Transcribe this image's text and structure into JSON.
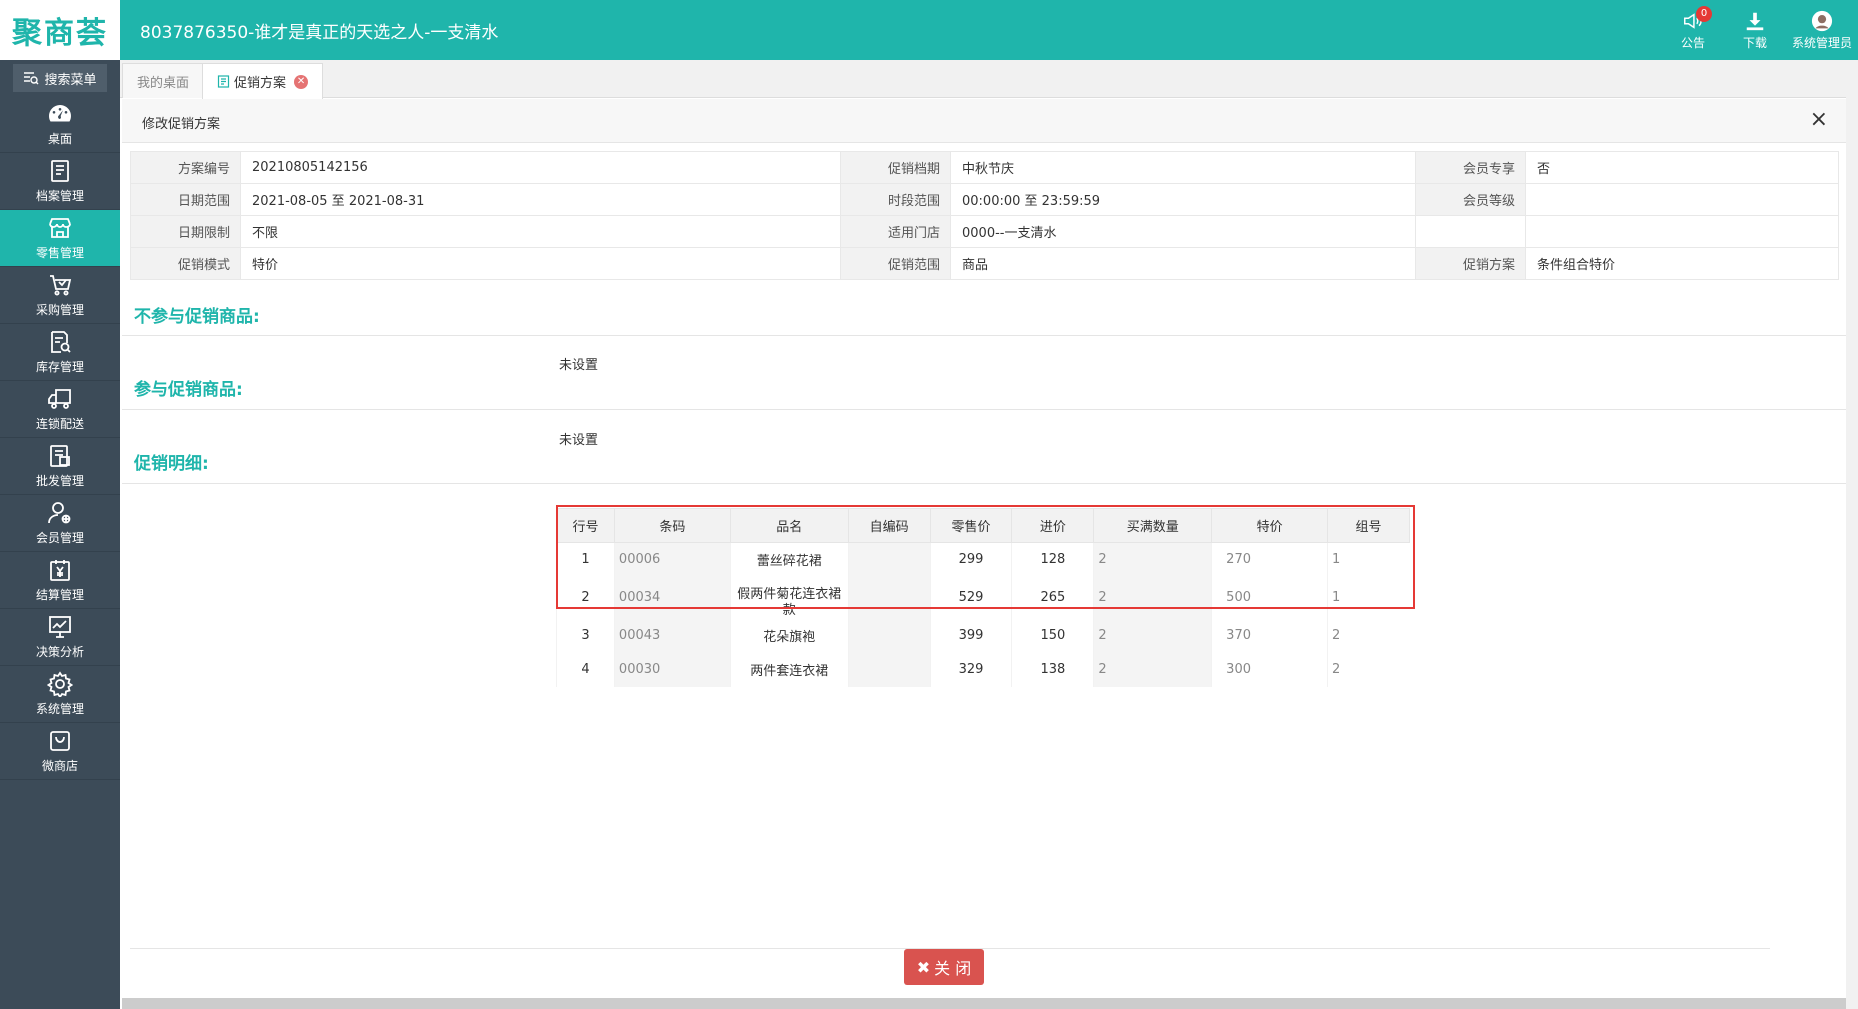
{
  "header": {
    "logo": "聚商荟",
    "title": "8037876350-谁才是真正的天选之人-一支清水",
    "actions": [
      {
        "label": "公告",
        "icon": "speaker-icon",
        "badge": "0"
      },
      {
        "label": "下载",
        "icon": "download-icon"
      },
      {
        "label": "系统管理员",
        "icon": "avatar-icon"
      }
    ]
  },
  "sidebar": {
    "search_label": "搜索菜单",
    "items": [
      {
        "label": "桌面",
        "icon": "dashboard-icon"
      },
      {
        "label": "档案管理",
        "icon": "archive-icon"
      },
      {
        "label": "零售管理",
        "icon": "store-icon",
        "active": true
      },
      {
        "label": "采购管理",
        "icon": "cart-icon"
      },
      {
        "label": "库存管理",
        "icon": "inventory-icon"
      },
      {
        "label": "连锁配送",
        "icon": "truck-icon"
      },
      {
        "label": "批发管理",
        "icon": "wholesale-icon"
      },
      {
        "label": "会员管理",
        "icon": "member-icon"
      },
      {
        "label": "结算管理",
        "icon": "settlement-icon"
      },
      {
        "label": "决策分析",
        "icon": "analysis-icon"
      },
      {
        "label": "系统管理",
        "icon": "gear-icon"
      },
      {
        "label": "微商店",
        "icon": "shop-bag-icon"
      }
    ]
  },
  "tabs": [
    {
      "label": "我的桌面"
    },
    {
      "label": "促销方案",
      "active": true
    }
  ],
  "panel": {
    "title": "修改促销方案",
    "close": "×"
  },
  "info": {
    "rows": [
      [
        {
          "label": "方案编号",
          "value": "20210805142156"
        },
        {
          "label": "促销档期",
          "value": "中秋节庆"
        },
        {
          "label": "会员专享",
          "value": "否"
        }
      ],
      [
        {
          "label": "日期范围",
          "value": "2021-08-05 至 2021-08-31"
        },
        {
          "label": "时段范围",
          "value": "00:00:00 至 23:59:59"
        },
        {
          "label": "会员等级",
          "value": ""
        }
      ],
      [
        {
          "label": "日期限制",
          "value": "不限"
        },
        {
          "label": "适用门店",
          "value": "0000--一支清水"
        },
        {
          "label": "",
          "value": ""
        }
      ],
      [
        {
          "label": "促销模式",
          "value": "特价"
        },
        {
          "label": "促销范围",
          "value": "商品"
        },
        {
          "label": "促销方案",
          "value": "条件组合特价"
        }
      ]
    ]
  },
  "sections": {
    "exclude_title": "不参与促销商品:",
    "exclude_value": "未设置",
    "include_title": "参与促销商品:",
    "include_value": "未设置",
    "detail_title": "促销明细:"
  },
  "detail": {
    "columns": [
      "行号",
      "条码",
      "品名",
      "自编码",
      "零售价",
      "进价",
      "买满数量",
      "特价",
      "组号"
    ],
    "rows": [
      {
        "no": "1",
        "barcode": "00006",
        "name": "蕾丝碎花裙",
        "code": "",
        "retail": "299",
        "cost": "128",
        "qty": "2",
        "special": "270",
        "group": "1"
      },
      {
        "no": "2",
        "barcode": "00034",
        "name": "假两件菊花连衣裙款",
        "code": "",
        "retail": "529",
        "cost": "265",
        "qty": "2",
        "special": "500",
        "group": "1"
      },
      {
        "no": "3",
        "barcode": "00043",
        "name": "花朵旗袍",
        "code": "",
        "retail": "399",
        "cost": "150",
        "qty": "2",
        "special": "370",
        "group": "2"
      },
      {
        "no": "4",
        "barcode": "00030",
        "name": "两件套连衣裙",
        "code": "",
        "retail": "329",
        "cost": "138",
        "qty": "2",
        "special": "300",
        "group": "2"
      }
    ]
  },
  "footer": {
    "close_label": "关 闭"
  }
}
